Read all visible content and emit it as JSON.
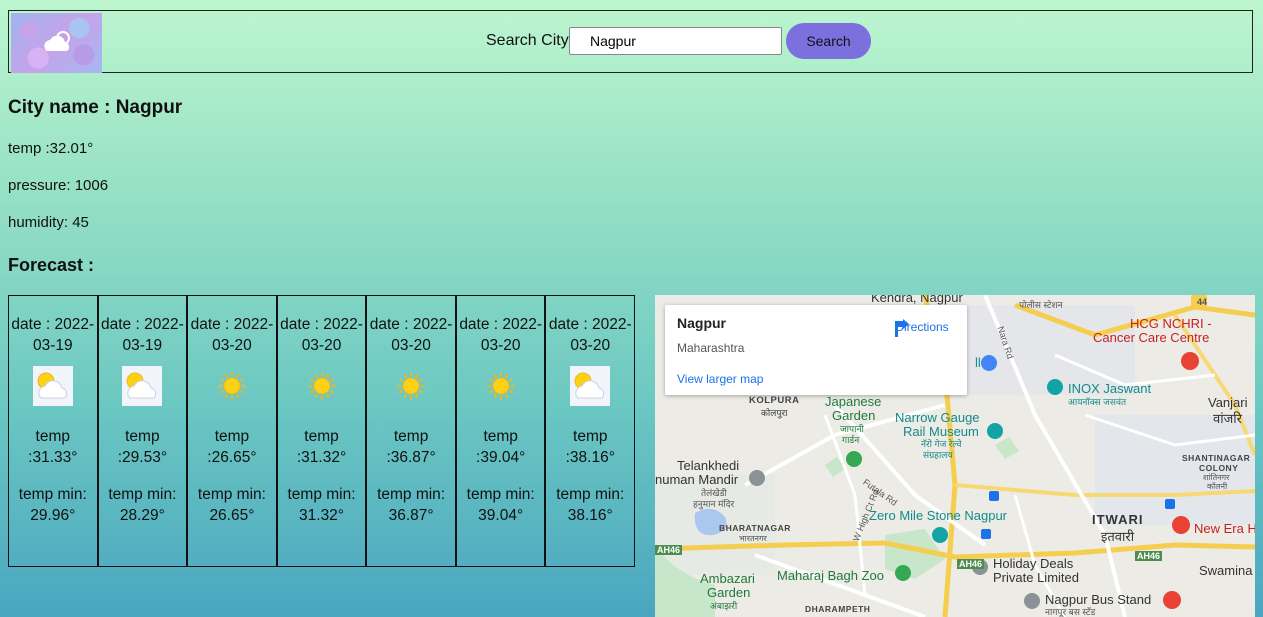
{
  "header": {
    "search_label": "Search City",
    "search_value": "Nagpur",
    "search_button": "Search"
  },
  "weather": {
    "city_name": "City name : Nagpur",
    "temp": "temp :32.01°",
    "pressure": "pressure: 1006",
    "humidity": "humidity: 45"
  },
  "forecast_title": "Forecast :",
  "forecast": [
    {
      "date": "date : 2022-03-19",
      "icon": "sun-behind-cloud-icon",
      "temp": "temp :31.33°",
      "temp_min": "temp min: 29.96°"
    },
    {
      "date": "date : 2022-03-19",
      "icon": "sun-behind-cloud-icon",
      "temp": "temp :29.53°",
      "temp_min": "temp min: 28.29°"
    },
    {
      "date": "date : 2022-03-20",
      "icon": "sun-icon",
      "temp": "temp :26.65°",
      "temp_min": "temp min: 26.65°"
    },
    {
      "date": "date : 2022-03-20",
      "icon": "sun-icon",
      "temp": "temp :31.32°",
      "temp_min": "temp min: 31.32°"
    },
    {
      "date": "date : 2022-03-20",
      "icon": "sun-icon",
      "temp": "temp :36.87°",
      "temp_min": "temp min: 36.87°"
    },
    {
      "date": "date : 2022-03-20",
      "icon": "sun-icon",
      "temp": "temp :39.04°",
      "temp_min": "temp min: 39.04°"
    },
    {
      "date": "date : 2022-03-20",
      "icon": "sun-behind-cloud-icon",
      "temp": "temp :38.16°",
      "temp_min": "temp min: 38.16°"
    }
  ],
  "map": {
    "info_title": "Nagpur",
    "info_region": "Maharashtra",
    "directions": "Directions",
    "view_larger": "View larger map",
    "labels": {
      "kendra": "Kendra, Nagpur",
      "police": "पोलीस स्टेशन",
      "hcg1": "HCG NCHRI -",
      "hcg2": "Cancer Care Centre",
      "inox1": "INOX Jaswant",
      "inox2": "आयनॉक्स जसवंत",
      "vanjari1": "Vanjari",
      "vanjari2": "वांजरि",
      "kolpura1": "KOLPURA",
      "kolpura2": "कोलपुरा",
      "japanese1": "Japanese",
      "japanese2": "Garden",
      "japanese3": "जापानी",
      "japanese4": "गार्डन",
      "narrow1": "Narrow Gauge",
      "narrow2": "Rail Museum",
      "narrow3": "नॅरो गेज रेल्वे",
      "narrow4": "संग्रहालय",
      "shanti1": "SHANTINAGAR",
      "shanti2": "COLONY",
      "shanti3": "शांतिनगर",
      "shanti4": "कॉलनी",
      "telan1": "Telankhedi",
      "telan2": "numan Mandir",
      "telan3": "तेलंखेडी",
      "telan4": "हनुमान मंदिर",
      "bharat1": "BHARATNAGAR",
      "bharat2": "भारतनगर",
      "zero": "Zero Mile Stone Nagpur",
      "itwari1": "ITWARI",
      "itwari2": "इतवारी",
      "newera": "New Era H",
      "holiday1": "Holiday Deals",
      "holiday2": "Private Limited",
      "maharaj": "Maharaj Bagh Zoo",
      "ambazari1": "Ambazari",
      "ambazari2": "Garden",
      "ambazari3": "अंबाझरी",
      "dharam": "DHARAMPETH",
      "busstand1": "Nagpur Bus Stand",
      "busstand2": "नागपूर बस स्टॅंड",
      "swamina": "Swamina",
      "ah46a": "AH46",
      "ah46b": "AH46",
      "ah46c": "AH46",
      "r44": "44",
      "narard": "Nara Rd",
      "futala": "Futala Rd",
      "whigh": "W High Ct Rd",
      "ll": "ll"
    }
  },
  "colors": {
    "search_button": "#7b70dd",
    "link": "#1a73e8"
  }
}
